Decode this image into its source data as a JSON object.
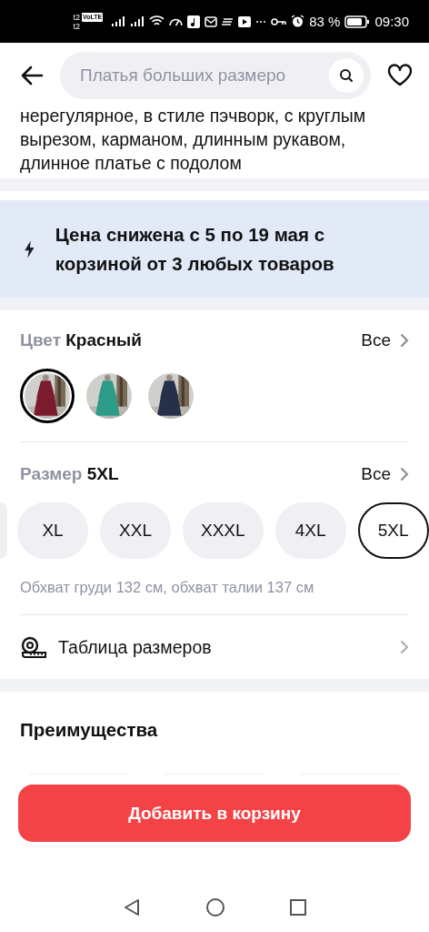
{
  "status_bar": {
    "carrier_top": "t2",
    "volte": "VoLTE",
    "carrier_bottom": "t2",
    "battery": "83 %",
    "time": "09:30"
  },
  "header": {
    "search_placeholder": "Платья больших размеро"
  },
  "description": "нерегулярное, в стиле пэчворк, с круглым вырезом, карманом, длинным рукавом, длинное платье с подолом",
  "promo": {
    "text": "Цена снижена с 5 по 19 мая с корзиной от 3 любых товаров"
  },
  "color": {
    "label": "Цвет",
    "value": "Красный",
    "all": "Все",
    "swatches": [
      {
        "kind": "picture",
        "selected": true
      },
      {
        "kind": "picture",
        "selected": false
      },
      {
        "kind": "picture",
        "selected": false
      }
    ]
  },
  "size": {
    "label": "Размер",
    "value": "5XL",
    "all": "Все",
    "options": [
      {
        "label": "XL",
        "selected": false
      },
      {
        "label": "XXL",
        "selected": false
      },
      {
        "label": "XXXL",
        "selected": false
      },
      {
        "label": "4XL",
        "selected": false
      },
      {
        "label": "5XL",
        "selected": true
      }
    ],
    "hint": "Обхват груди 132 см, обхват талии 137 см"
  },
  "size_table": {
    "label": "Таблица размеров"
  },
  "benefits": {
    "title": "Преимущества"
  },
  "cart_button": "Добавить в корзину"
}
